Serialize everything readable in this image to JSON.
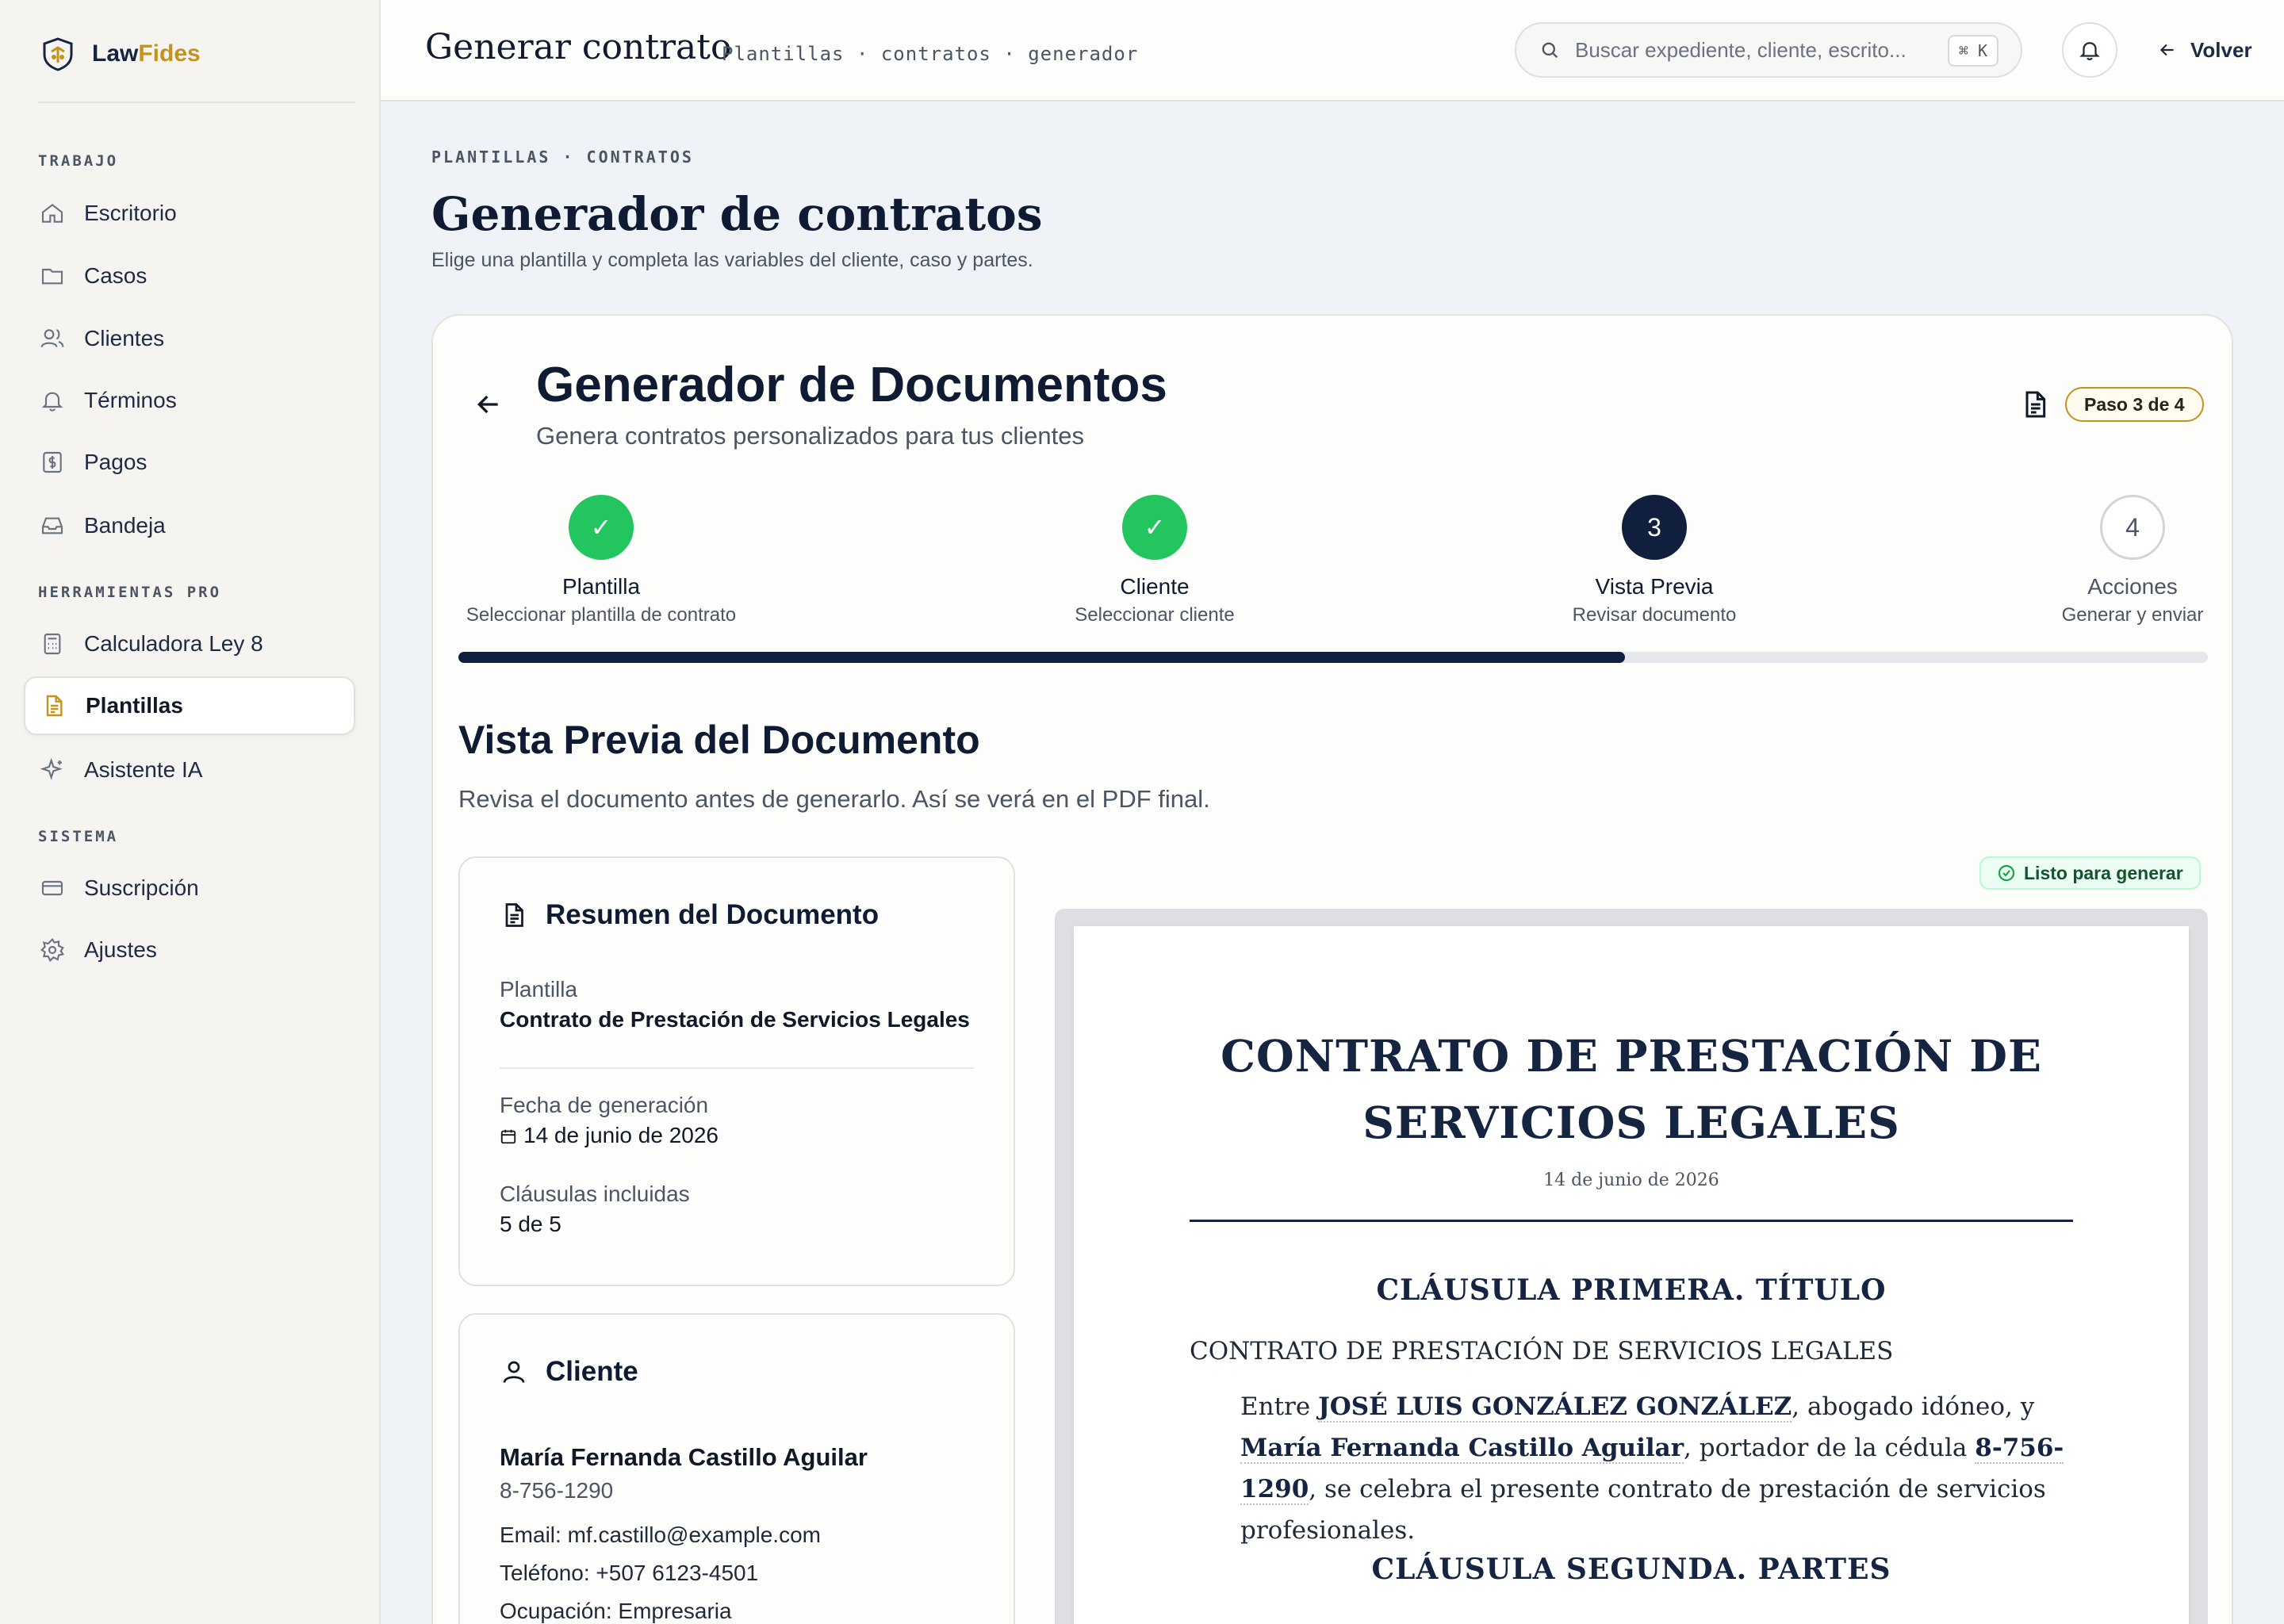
{
  "brand": {
    "part1": "Law",
    "part2": "Fides"
  },
  "sidebar": {
    "sections": [
      {
        "label": "TRABAJO",
        "items": [
          {
            "label": "Escritorio",
            "icon": "home-icon"
          },
          {
            "label": "Casos",
            "icon": "folder-icon"
          },
          {
            "label": "Clientes",
            "icon": "users-icon"
          },
          {
            "label": "Términos",
            "icon": "bell-icon"
          },
          {
            "label": "Pagos",
            "icon": "dollar-icon"
          },
          {
            "label": "Bandeja",
            "icon": "inbox-icon"
          }
        ]
      },
      {
        "label": "HERRAMIENTAS PRO",
        "items": [
          {
            "label": "Calculadora Ley 8",
            "icon": "calculator-icon"
          },
          {
            "label": "Plantillas",
            "icon": "document-icon",
            "active": true
          },
          {
            "label": "Asistente IA",
            "icon": "sparkle-icon"
          }
        ]
      },
      {
        "label": "SISTEMA",
        "items": [
          {
            "label": "Suscripción",
            "icon": "credit-card-icon"
          },
          {
            "label": "Ajustes",
            "icon": "gear-icon"
          }
        ]
      }
    ]
  },
  "header": {
    "title": "Generar contrato",
    "breadcrumb": "Plantillas · contratos · generador",
    "search_placeholder": "Buscar expediente, cliente, escrito...",
    "shortcut": "⌘ K",
    "back_label": "Volver"
  },
  "page": {
    "eyebrow": "PLANTILLAS · CONTRATOS",
    "title": "Generador de contratos",
    "subtitle": "Elige una plantilla y completa las variables del cliente, caso y partes."
  },
  "card": {
    "title": "Generador de Documentos",
    "subtitle": "Genera contratos personalizados para tus clientes",
    "step_badge": "Paso 3 de 4",
    "steps": [
      {
        "marker": "✓",
        "label": "Plantilla",
        "desc": "Seleccionar plantilla de contrato",
        "state": "done"
      },
      {
        "marker": "✓",
        "label": "Cliente",
        "desc": "Seleccionar cliente",
        "state": "done"
      },
      {
        "marker": "3",
        "label": "Vista Previa",
        "desc": "Revisar documento",
        "state": "current"
      },
      {
        "marker": "4",
        "label": "Acciones",
        "desc": "Generar y enviar",
        "state": "todo"
      }
    ],
    "progress_fraction": 0.667,
    "section_title": "Vista Previa del Documento",
    "section_sub": "Revisa el documento antes de generarlo. Así se verá en el PDF final."
  },
  "summary": {
    "title": "Resumen del Documento",
    "template_label": "Plantilla",
    "template_value": "Contrato de Prestación de Servicios Legales",
    "date_label": "Fecha de generación",
    "date_value": "14 de junio de 2026",
    "clauses_label": "Cláusulas incluidas",
    "clauses_value": "5 de 5"
  },
  "client": {
    "title": "Cliente",
    "name": "María Fernanda Castillo Aguilar",
    "id": "8-756-1290",
    "email_label": "Email:",
    "email": "mf.castillo@example.com",
    "phone_label": "Teléfono:",
    "phone": "+507 6123-4501",
    "occupation_label": "Ocupación:",
    "occupation": "Empresaria"
  },
  "preview": {
    "ready_label": "Listo para generar",
    "doc_title_line1": "CONTRATO DE PRESTACIÓN DE",
    "doc_title_line2": "SERVICIOS LEGALES",
    "doc_date": "14 de junio de 2026",
    "clause1_heading": "CLÁUSULA PRIMERA. TÍTULO",
    "clause1_line": "CONTRATO DE PRESTACIÓN DE SERVICIOS LEGALES",
    "p_entre": "Entre ",
    "lawyer": "JOSÉ LUIS GONZÁLEZ GONZÁLEZ",
    "p_mid1": ", abogado idóneo, y ",
    "client_name": "María Fernanda Castillo Aguilar",
    "p_mid2": ", portador de la cédula ",
    "client_id": "8-756-1290",
    "p_end": ", se celebra el presente contrato de prestación de servicios profesionales.",
    "clause2_heading": "CLÁUSULA SEGUNDA. PARTES"
  },
  "colors": {
    "accent": "#c4931f",
    "navy": "#0f1f3d",
    "success": "#22c55e"
  }
}
